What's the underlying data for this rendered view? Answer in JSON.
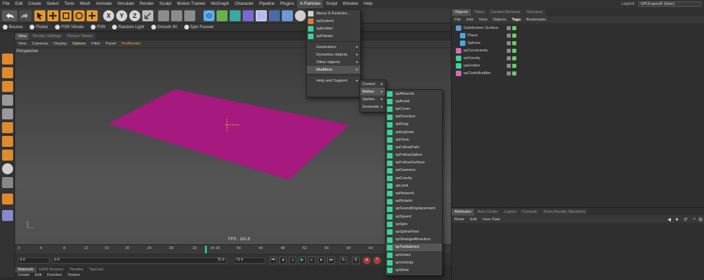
{
  "menubar": {
    "items": [
      "File",
      "Edit",
      "Create",
      "Select",
      "Tools",
      "Mesh",
      "Animate",
      "Simulate",
      "Render",
      "Sculpt",
      "Motion Tracker",
      "MoGraph",
      "Character",
      "Pipeline",
      "Plugins",
      "X-Particles",
      "Script",
      "Window",
      "Help"
    ],
    "active": "X-Particles",
    "layout_label": "Layout:",
    "layout_value": "GPULayout5 (User)"
  },
  "toolbar": {
    "bounce_label": "Bounce",
    "axis_labels": [
      "X",
      "Y",
      "Z"
    ]
  },
  "mograph_presets": [
    "Bounce",
    "Flicker",
    "PSR Vibrate",
    "PSR",
    "Random Light",
    "Smooth 90",
    "Spin Forever"
  ],
  "viewport": {
    "tabs": [
      "View",
      "Render Settings",
      "Picture Viewer"
    ],
    "menu": [
      "View",
      "Cameras",
      "Display",
      "Options",
      "Filter",
      "Panel",
      "ProRender"
    ],
    "label": "Perspective",
    "fps": "FPS : 181.8",
    "plane_color": "#a6197e"
  },
  "timeline": {
    "ticks": [
      "0",
      "4",
      "8",
      "12",
      "16",
      "20",
      "24",
      "28",
      "32",
      "34 36",
      "40",
      "44",
      "48",
      "52",
      "56",
      "60",
      "64"
    ],
    "current_frame": "0 F",
    "start_field": "0 F",
    "end_field": "72 F",
    "end_field2": "72 F"
  },
  "materials": {
    "tabs": [
      "Materials",
      "HDRI Browser",
      "Timeline",
      "TopCoat"
    ],
    "menu": [
      "Create",
      "Edit",
      "Function",
      "Texture"
    ]
  },
  "objects_panel": {
    "tabs": [
      "Objects",
      "Takes",
      "Content Browser",
      "Structure"
    ],
    "menu": [
      "File",
      "Edit",
      "View",
      "Objects",
      "Tags",
      "Bookmarks"
    ],
    "objects": [
      {
        "name": "Subdivision Surface",
        "color": "#5a9bd8"
      },
      {
        "name": "Plane",
        "color": "#4aa8e0"
      },
      {
        "name": "Sphere",
        "color": "#4aa8e0"
      },
      {
        "name": "xpConstraints",
        "color": "#d86cb4"
      },
      {
        "name": "xpGravity",
        "color": "#3ad39a"
      },
      {
        "name": "xpEmitter",
        "color": "#3ad39a"
      },
      {
        "name": "xpClothModifier",
        "color": "#d86cb4"
      }
    ]
  },
  "attributes_panel": {
    "tabs": [
      "Attributes",
      "Axis Center",
      "Layers",
      "Console",
      "Team Render Machines"
    ],
    "menu": [
      "Mode",
      "Edit",
      "User Data"
    ]
  },
  "xparticles_menu": {
    "items": [
      {
        "label": "About X-Particles...",
        "type": "icon"
      },
      {
        "label": "xpSystem",
        "type": "icon"
      },
      {
        "label": "xpEmitter",
        "type": "icon"
      },
      {
        "label": "xpPainter",
        "type": "icon"
      },
      {
        "label": "Generators",
        "type": "sub"
      },
      {
        "label": "Dynamics objects",
        "type": "sub"
      },
      {
        "label": "Other objects",
        "type": "sub"
      },
      {
        "label": "Modifiers",
        "type": "sub"
      },
      {
        "label": "Help and Support",
        "type": "sub"
      }
    ],
    "highlighted": "Modifiers"
  },
  "modifiers_menu": {
    "items": [
      "Control",
      "Motion",
      "Sprites",
      "Generate"
    ],
    "highlighted": "Motion"
  },
  "motion_menu": {
    "items": [
      "xpAttractor",
      "xpAvoid",
      "xpCover",
      "xpDirection",
      "xpDrag",
      "xpExplode",
      "xpFlock",
      "xpFollowPath",
      "xpFollowSpline",
      "xpFollowSurface",
      "xpGaseous",
      "xpGravity",
      "xpLimit",
      "xpNetwork",
      "xpRotator",
      "xpSoundDisplacement",
      "xpSpeed",
      "xpSpin",
      "xpSplineFlow",
      "xpStrangeAttractors",
      "xpTurbulence",
      "xpVortex",
      "xpVorticity",
      "xpWind"
    ],
    "highlighted": "xpTurbulence",
    "icon_color": "#3ad39a"
  }
}
